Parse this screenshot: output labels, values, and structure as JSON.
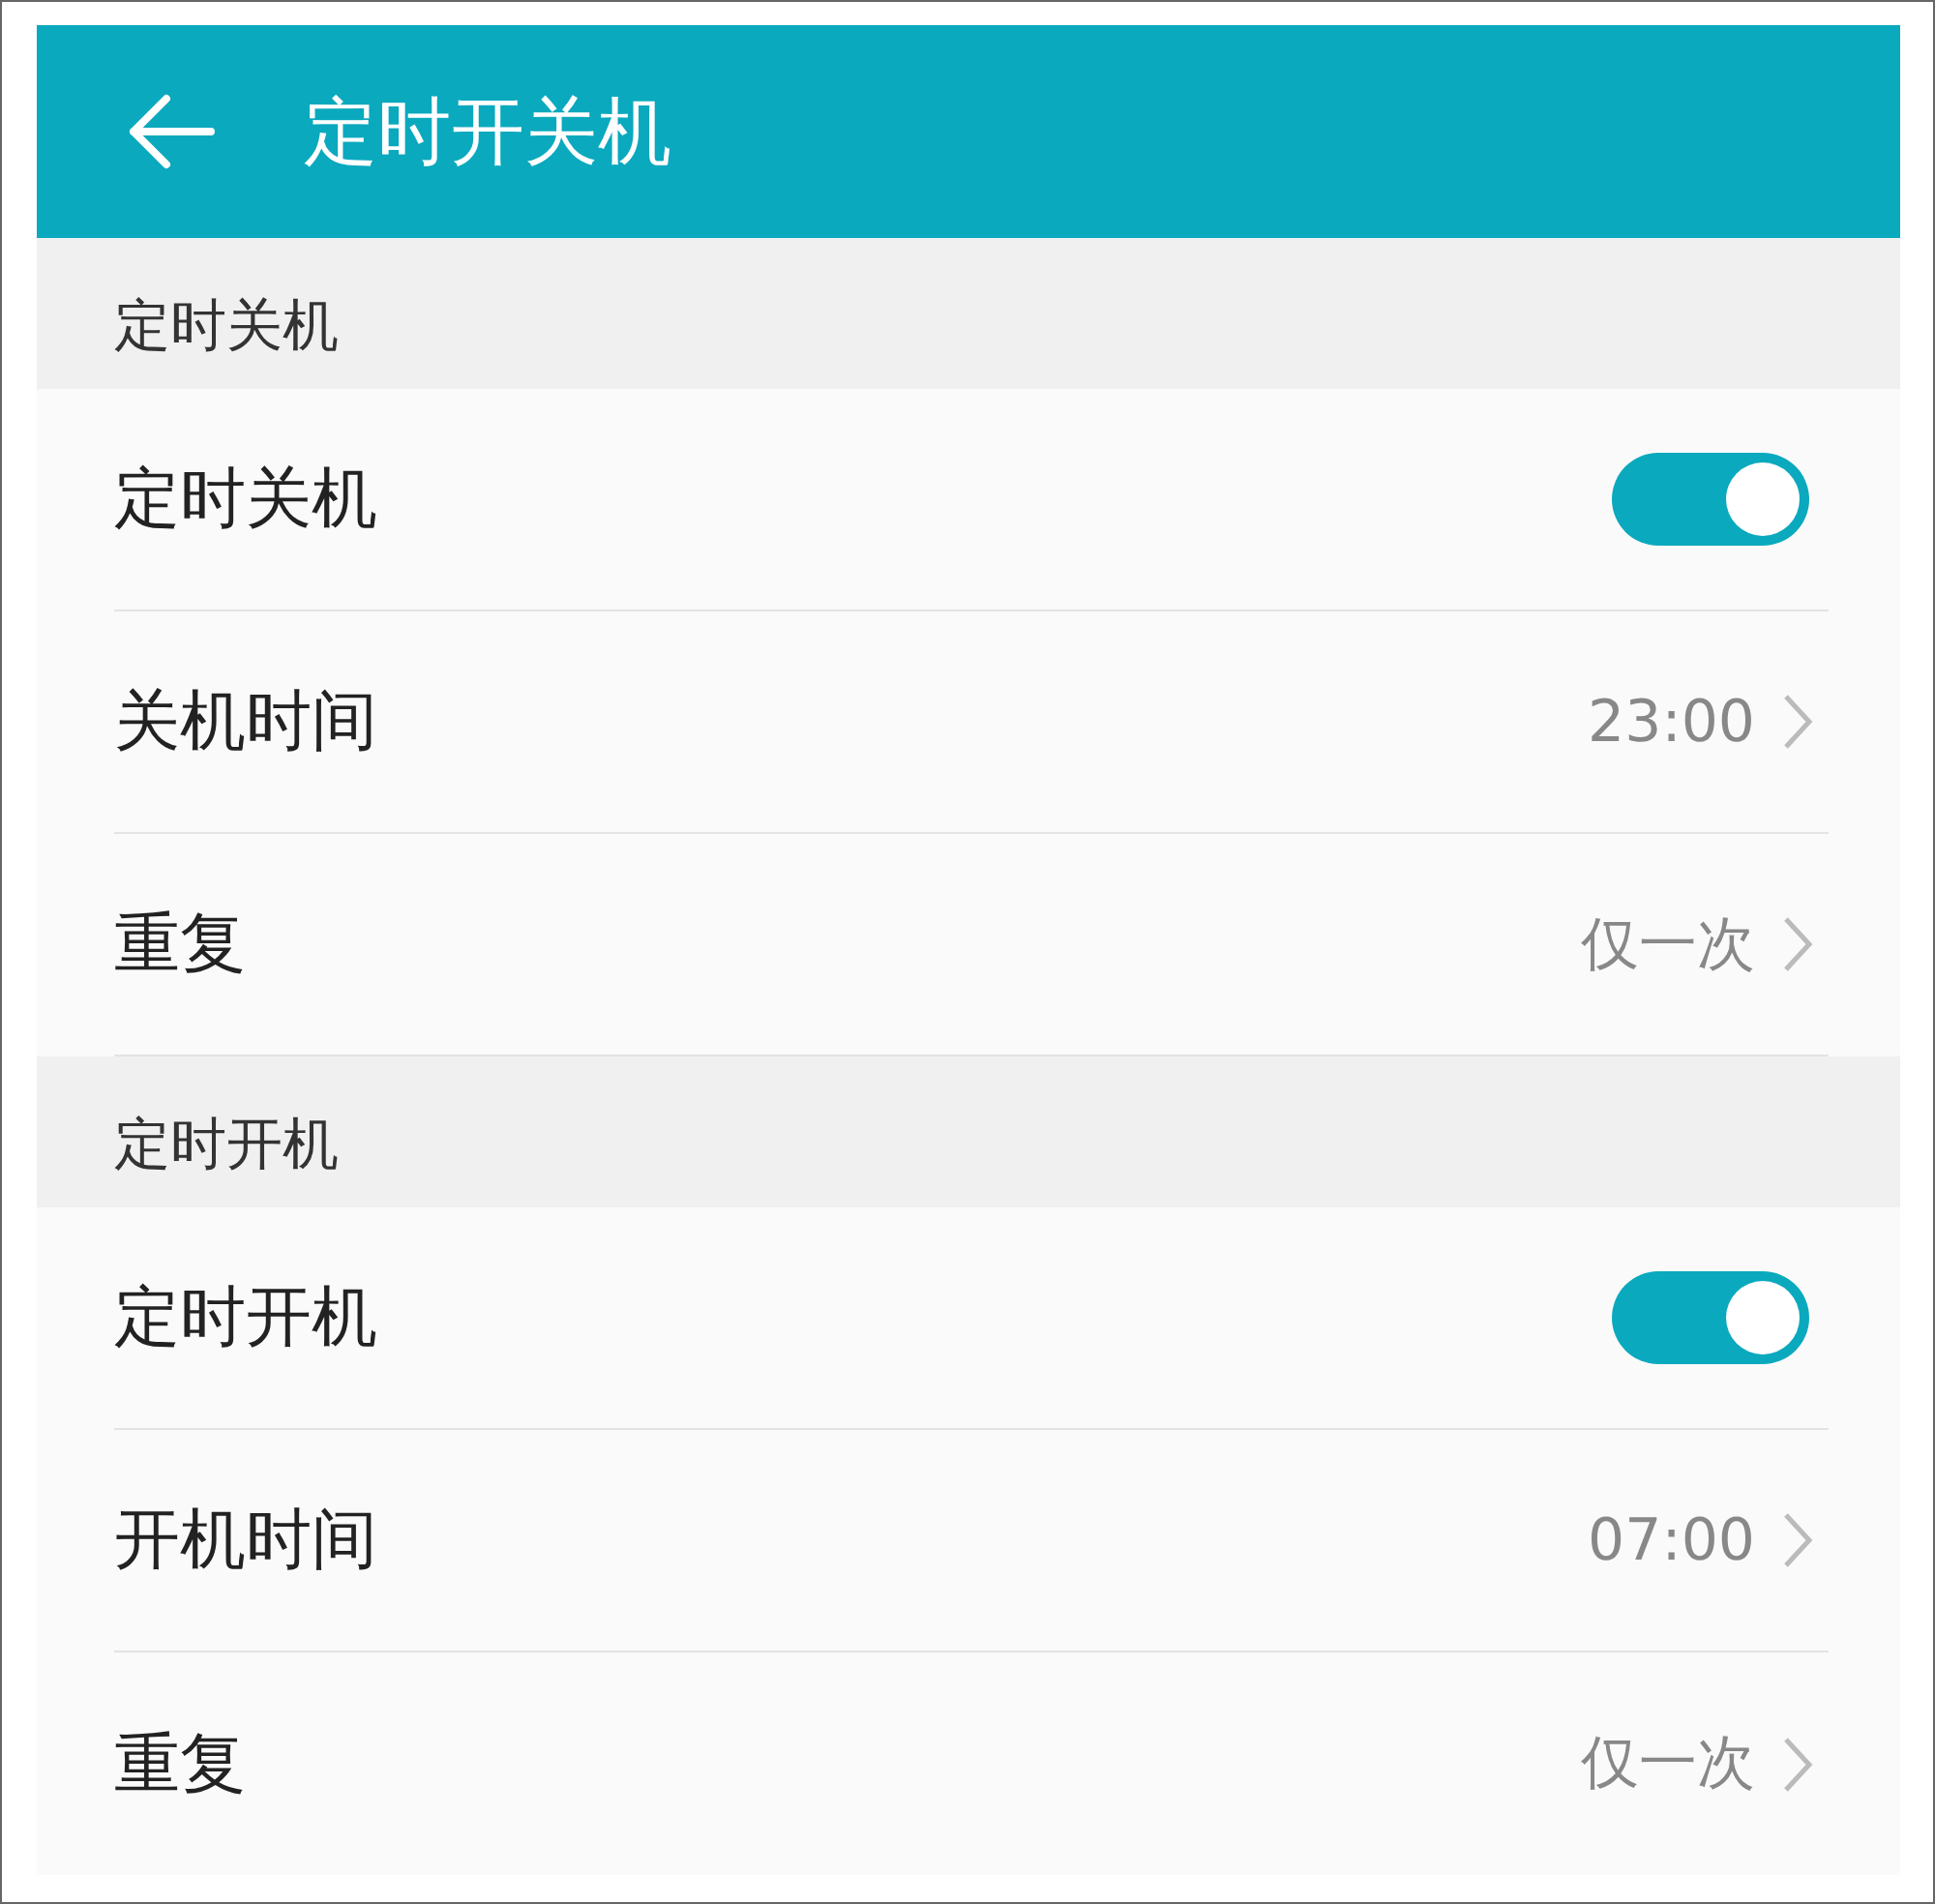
{
  "header": {
    "title": "定时开关机"
  },
  "sections": [
    {
      "title": "定时关机",
      "rows": [
        {
          "kind": "toggle",
          "label": "定时关机",
          "on": true
        },
        {
          "kind": "value",
          "label": "关机时间",
          "value": "23:00"
        },
        {
          "kind": "value",
          "label": "重复",
          "value": "仅一次"
        }
      ]
    },
    {
      "title": "定时开机",
      "rows": [
        {
          "kind": "toggle",
          "label": "定时开机",
          "on": true
        },
        {
          "kind": "value",
          "label": "开机时间",
          "value": "07:00"
        },
        {
          "kind": "value",
          "label": "重复",
          "value": "仅一次"
        }
      ]
    }
  ]
}
